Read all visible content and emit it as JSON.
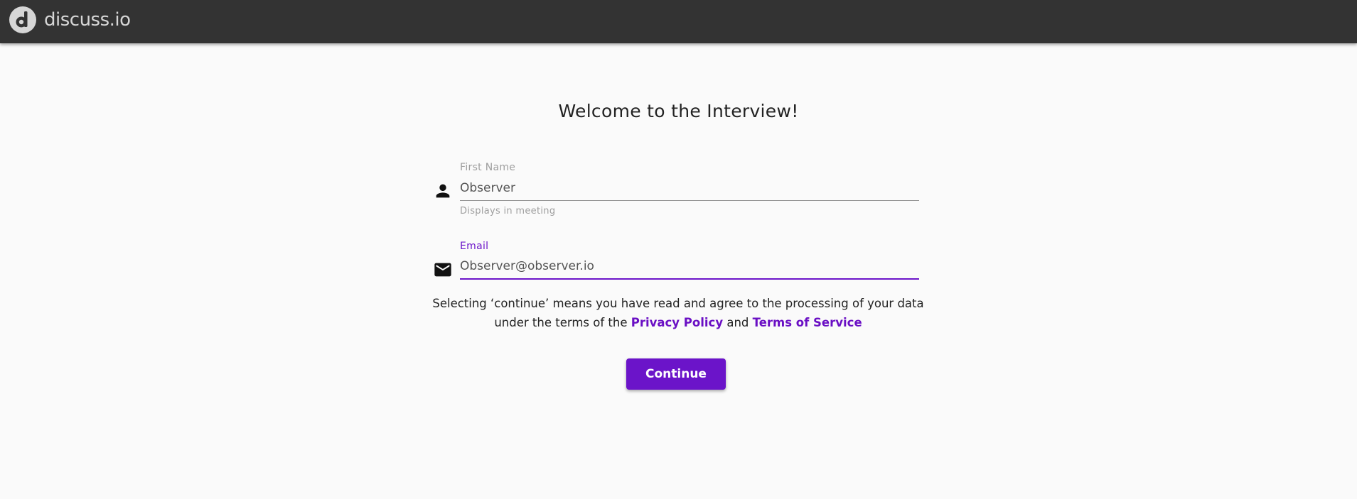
{
  "app": {
    "name": "discuss.io",
    "brand_bar_color": "#333333"
  },
  "page": {
    "title": "Welcome to the Interview!"
  },
  "form": {
    "first_name": {
      "label": "First Name",
      "value": "Observer",
      "hint": "Displays in meeting",
      "icon": "person-icon"
    },
    "email": {
      "label": "Email",
      "value": "Observer@observer.io",
      "icon": "mail-icon",
      "focused": true
    }
  },
  "consent": {
    "text_before": "Selecting ‘continue’ means you have read and agree to the processing of your data under the terms of the",
    "privacy_link": "Privacy Policy",
    "joiner": "and",
    "terms_link": "Terms of Service"
  },
  "actions": {
    "continue_label": "Continue"
  },
  "colors": {
    "accent": "#6b14c9",
    "background": "#fafafa",
    "input_underline": "#949494"
  }
}
